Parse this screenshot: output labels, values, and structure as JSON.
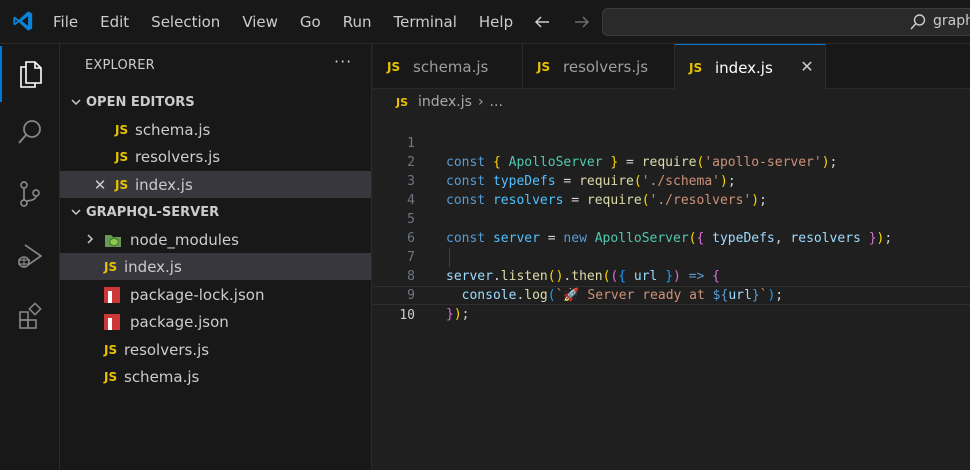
{
  "menu": [
    "File",
    "Edit",
    "Selection",
    "View",
    "Go",
    "Run",
    "Terminal",
    "Help"
  ],
  "search": {
    "text": "graph"
  },
  "sidebar": {
    "title": "EXPLORER",
    "more": "···",
    "open_editors": {
      "label": "OPEN EDITORS",
      "items": [
        {
          "badge": "JS",
          "name": "schema.js"
        },
        {
          "badge": "JS",
          "name": "resolvers.js"
        },
        {
          "badge": "JS",
          "name": "index.js",
          "close": "✕"
        }
      ]
    },
    "project": {
      "label": "GRAPHQL-SERVER",
      "items": [
        {
          "name": "node_modules"
        },
        {
          "badge": "JS",
          "name": "index.js"
        },
        {
          "name": "package-lock.json"
        },
        {
          "name": "package.json"
        },
        {
          "badge": "JS",
          "name": "resolvers.js"
        },
        {
          "badge": "JS",
          "name": "schema.js"
        }
      ]
    }
  },
  "tabs": [
    {
      "badge": "JS",
      "label": "schema.js"
    },
    {
      "badge": "JS",
      "label": "resolvers.js"
    },
    {
      "badge": "JS",
      "label": "index.js",
      "close": "✕"
    }
  ],
  "breadcrumb": {
    "badge": "JS",
    "file": "index.js",
    "sep": "›",
    "rest": "..."
  },
  "editor": {
    "line_numbers": [
      "1",
      "2",
      "3",
      "4",
      "5",
      "6",
      "7",
      "8",
      "9",
      "10"
    ],
    "lines": [
      "const { ApolloServer } = require('apollo-server');",
      "const typeDefs = require('./schema');",
      "const resolvers = require('./resolvers');",
      "",
      "const server = new ApolloServer({ typeDefs, resolvers });",
      "",
      "server.listen().then(({ url }) => {",
      "  console.log(`🚀 Server ready at ${url}`);",
      "});",
      ""
    ],
    "current_line": 10
  },
  "colors": {
    "accent": "#0078d4",
    "js_badge": "#e8c200",
    "npm": "#cb3837",
    "keyword": "#569cd6",
    "string": "#ce9178"
  }
}
